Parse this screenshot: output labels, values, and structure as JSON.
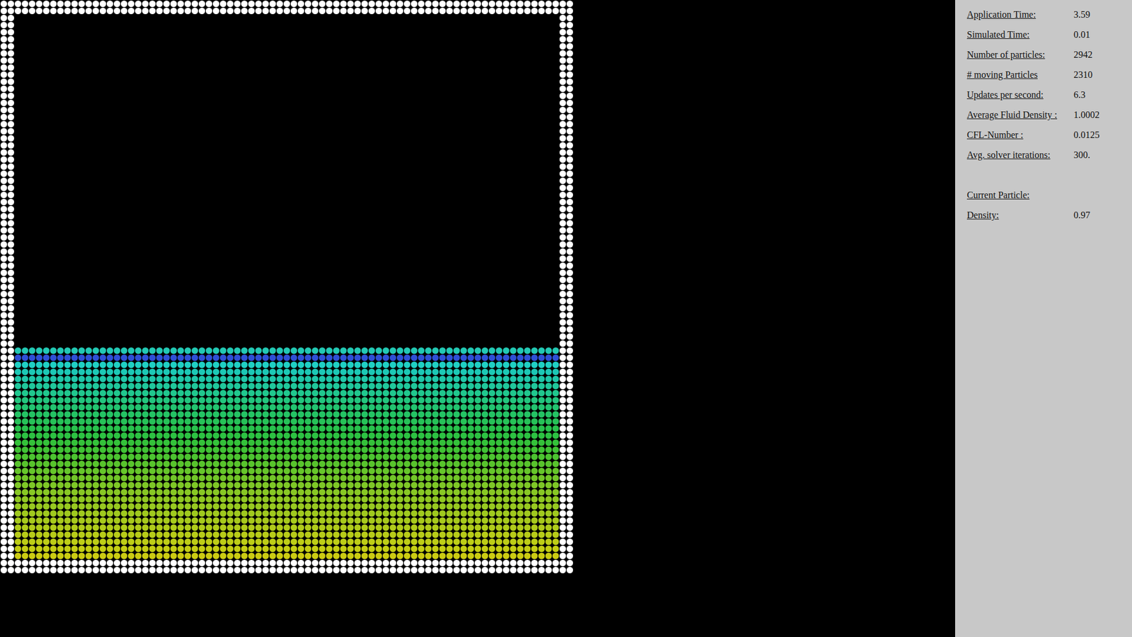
{
  "simulation": {
    "fluid": {
      "columns": 77,
      "rows": [
        {
          "color": "#22c9b4"
        },
        {
          "color": "#2f4fd6"
        },
        {
          "color": "#1fd0c4"
        },
        {
          "color": "#1cc9b6"
        },
        {
          "color": "#1ec7a8"
        },
        {
          "color": "#1fc89c"
        },
        {
          "color": "#20c88e"
        },
        {
          "color": "#22c67e"
        },
        {
          "color": "#22c470"
        },
        {
          "color": "#24c464"
        },
        {
          "color": "#26c258"
        },
        {
          "color": "#28c24c"
        },
        {
          "color": "#2cc242"
        },
        {
          "color": "#34c23a"
        },
        {
          "color": "#40c234"
        },
        {
          "color": "#4cc430"
        },
        {
          "color": "#58c42c"
        },
        {
          "color": "#66c62a"
        },
        {
          "color": "#72c628"
        },
        {
          "color": "#7ec826"
        },
        {
          "color": "#88c824"
        },
        {
          "color": "#90c822"
        },
        {
          "color": "#98ca20"
        },
        {
          "color": "#a0ca1e"
        },
        {
          "color": "#a8ca1c"
        },
        {
          "color": "#b0cc1a"
        },
        {
          "color": "#b8cc18"
        },
        {
          "color": "#bece16"
        },
        {
          "color": "#c4ce14"
        },
        {
          "color": "#cccc12"
        }
      ]
    }
  },
  "panel": {
    "stats": [
      {
        "label": "Application Time:",
        "value": "3.59"
      },
      {
        "label": "Simulated Time:",
        "value": "0.01"
      },
      {
        "label": "Number of particles:",
        "value": "2942"
      },
      {
        "label": "# moving Particles",
        "value": "2310"
      },
      {
        "label": "Updates per second:",
        "value": "6.3"
      },
      {
        "label": "Average Fluid Density :",
        "value": "1.0002"
      },
      {
        "label": "CFL-Number :",
        "value": "0.0125"
      },
      {
        "label": "Avg. solver iterations:",
        "value": "300."
      }
    ],
    "current_particle": {
      "title": "Current Particle:",
      "stats": [
        {
          "label": "Density:",
          "value": "0.97"
        }
      ]
    }
  }
}
